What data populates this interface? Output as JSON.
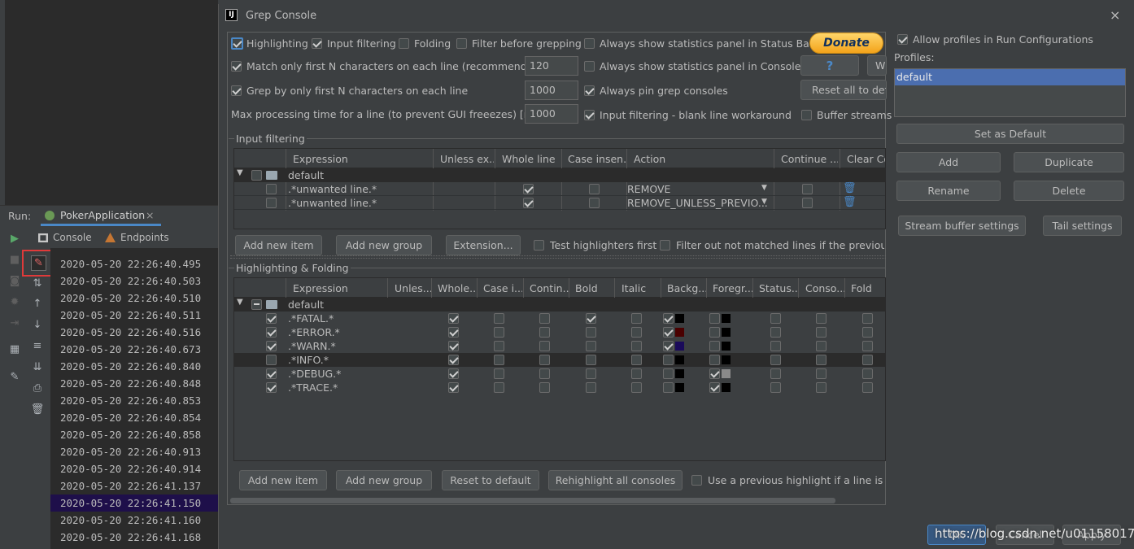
{
  "ide": {
    "run_label": "Run:",
    "run_tab": "PokerApplication",
    "console_tab": "Console",
    "endpoints_tab": "Endpoints",
    "log_lines": [
      "2020-05-20 22:26:40.495",
      "2020-05-20 22:26:40.503",
      "2020-05-20 22:26:40.510",
      "2020-05-20 22:26:40.511",
      "2020-05-20 22:26:40.516",
      "2020-05-20 22:26:40.673",
      "2020-05-20 22:26:40.840",
      "2020-05-20 22:26:40.848",
      "2020-05-20 22:26:40.853",
      "2020-05-20 22:26:40.854",
      "2020-05-20 22:26:40.858",
      "2020-05-20 22:26:40.913",
      "2020-05-20 22:26:40.914",
      "2020-05-20 22:26:41.137",
      "2020-05-20 22:26:41.150",
      "2020-05-20 22:26:41.160",
      "2020-05-20 22:26:41.168"
    ],
    "highlight_color": "#1e0f4a"
  },
  "dialog": {
    "title": "Grep Console",
    "top": {
      "highlighting": "Highlighting",
      "input_filtering": "Input filtering",
      "folding": "Folding",
      "filter_before": "Filter before grepping",
      "stats_status_bar": "Always show statistics panel in Status Bar",
      "donate": "Donate",
      "match_first_n": "Match only first N characters on each line (recommended)",
      "match_first_n_value": "120",
      "stats_console": "Always show statistics panel in Console",
      "help": "?",
      "w_btn": "W",
      "grep_first_n": "Grep by only first N characters on each line",
      "grep_first_n_value": "1000",
      "pin_consoles": "Always pin grep consoles",
      "reset_all": "Reset all to defa",
      "max_time": "Max processing time for a line (to prevent GUI freeezes) [ms]",
      "max_time_value": "1000",
      "blank_line": "Input filtering - blank line workaround",
      "buffer_streams": "Buffer streams"
    },
    "input_filtering": {
      "title": "Input filtering",
      "headers": [
        "Expression",
        "Unless ex...",
        "Whole line",
        "Case insen...",
        "Action",
        "Continue ...",
        "Clear Co"
      ],
      "group": "default",
      "rows": [
        {
          "expr": ".*unwanted line.*",
          "action": "REMOVE"
        },
        {
          "expr": ".*unwanted line.*",
          "action": "REMOVE_UNLESS_PREVIO..."
        }
      ],
      "add_item": "Add new item",
      "add_group": "Add new group",
      "extension": "Extension...",
      "test_highlighters": "Test highlighters first",
      "filter_out": "Filter out not matched lines if the previous o"
    },
    "highlighting": {
      "title": "Highlighting & Folding",
      "headers": [
        "Expression",
        "Unles...",
        "Whole...",
        "Case i...",
        "Contin...",
        "Bold",
        "Italic",
        "Backg...",
        "Foregr...",
        "Status...",
        "Conso...",
        "Fold"
      ],
      "group": "default",
      "rows": [
        {
          "expr": ".*FATAL.*",
          "bg": "#000000",
          "fg": "#000000"
        },
        {
          "expr": ".*ERROR.*",
          "bg": "#4a0000",
          "fg": "#000000"
        },
        {
          "expr": ".*WARN.*",
          "bg": "#1a0a5a",
          "fg": "#000000"
        },
        {
          "expr": ".*INFO.*",
          "bg": "#000000",
          "fg": "#000000"
        },
        {
          "expr": ".*DEBUG.*",
          "bg": "#000000",
          "fg": "#8a8a8a"
        },
        {
          "expr": ".*TRACE.*",
          "bg": "#000000",
          "fg": "#000000"
        }
      ],
      "add_item": "Add new item",
      "add_group": "Add new group",
      "reset_default": "Reset to default",
      "rehighlight": "Rehighlight all consoles",
      "use_previous": "Use a previous highlight if a line is no"
    },
    "profiles": {
      "allow": "Allow profiles in Run Configurations",
      "label": "Profiles:",
      "items": [
        "default"
      ],
      "set_default": "Set as Default",
      "add": "Add",
      "duplicate": "Duplicate",
      "rename": "Rename",
      "delete": "Delete",
      "stream_buffer": "Stream buffer settings",
      "tail": "Tail settings",
      "ok": "OK",
      "cancel": "Cancel",
      "apply": "Apply"
    }
  },
  "watermark": "https://blog.csdn.net/u011580177"
}
